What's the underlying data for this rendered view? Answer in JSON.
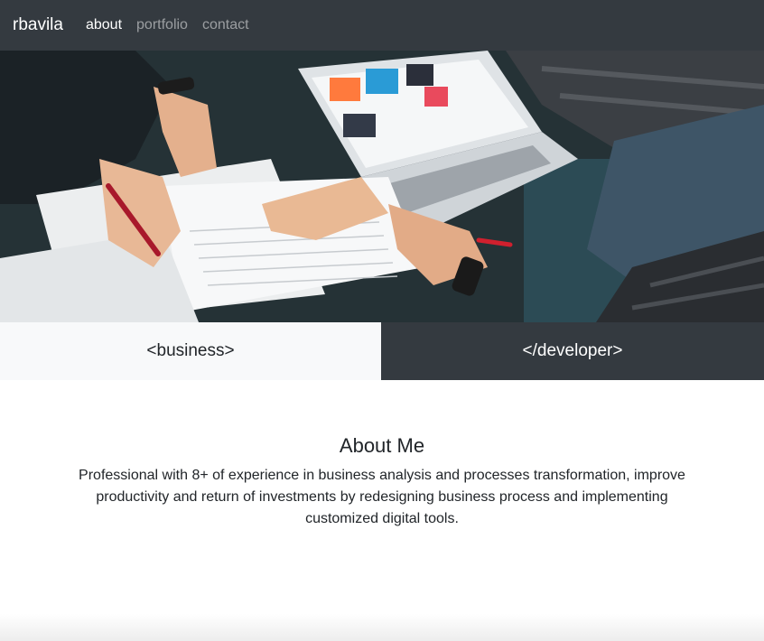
{
  "navbar": {
    "brand": "rbavila",
    "links": [
      {
        "label": "about",
        "active": true
      },
      {
        "label": "portfolio",
        "active": false
      },
      {
        "label": "contact",
        "active": false
      }
    ]
  },
  "split": {
    "left_label": "<business>",
    "right_label": "</developer>"
  },
  "about": {
    "title": "About Me",
    "text": "Professional with 8+ of experience in business analysis and processes transformation, improve productivity and return of investments by redesigning business process and implementing customized digital tools."
  },
  "colors": {
    "navbar_bg": "#343a40",
    "light_panel": "#f8f9fa",
    "dark_panel": "#343a40"
  }
}
